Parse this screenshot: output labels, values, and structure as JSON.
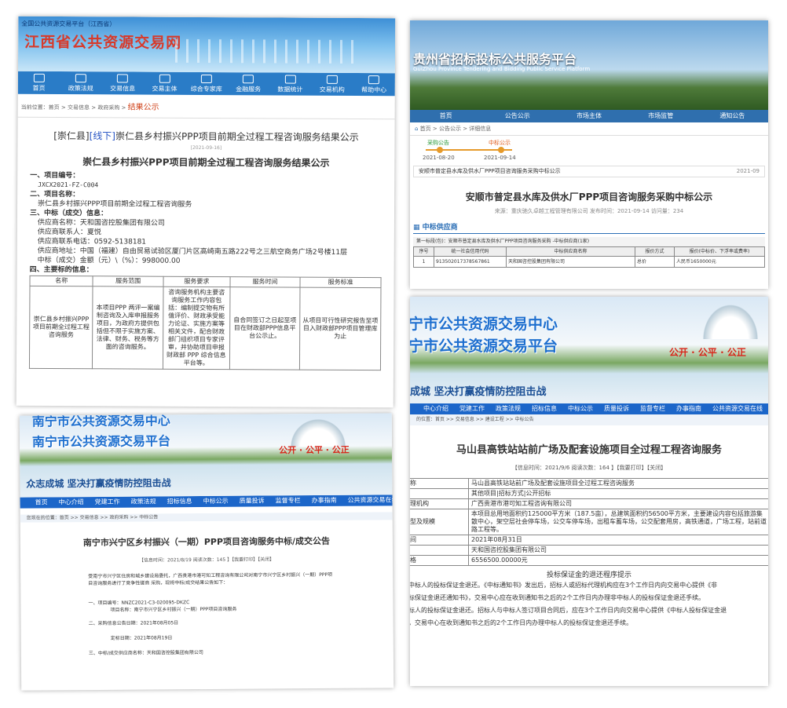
{
  "jx": {
    "platform": "全国公共资源交易平台（江西省）",
    "title": "江西省公共资源交易网",
    "nav": [
      "首页",
      "政策法规",
      "交易信息",
      "交易主体",
      "综合专家库",
      "金融服务",
      "数据统计",
      "交易机构",
      "帮助中心"
    ],
    "breadcrumb": "当前位置：首页 > 交易信息 > 政府采购 >",
    "breadcrumb_current": "结果公示",
    "heading_prefix": "[崇仁县]",
    "heading_tag": "[线下]",
    "heading_rest": "崇仁县乡村振兴PPP项目前期全过程工程咨询服务结果公示",
    "date": "[2021-09-16]",
    "doc_title": "崇仁县乡村振兴PPP项目前期全过程工程咨询服务结果公示",
    "lines": [
      "一、项目编号：",
      "JXCX2021-FZ-C004",
      "二、项目名称：",
      "崇仁县乡村振兴PPP项目前期全过程工程咨询服务",
      "三、中标（成交）信息：",
      "供应商名称：天和国咨控股集团有限公司",
      "供应商联系人：夏悦",
      "供应商联系电话：0592-5138181",
      "供应商地址：中国（福建）自由贸易试验区厦门片区高崎南五路222号之三航空商务广场2号楼11层",
      "中标（成交）金额（元）\\（%）：998000.00",
      "四、主要标的信息："
    ],
    "table_headers": [
      "名称",
      "服务范围",
      "服务要求",
      "服务时间",
      "服务标准"
    ],
    "table_row": [
      "崇仁县乡村振兴PPP项目前期全过程工程咨询服务",
      "本项目PPP 两评一案编制咨询及入库申报服务项目，为政府方提供包括但不限于实施方案、法律、财务、税务等方面的咨询服务。",
      "咨询服务机构主要咨询服务工作内容包括：编制提交物有所值评价、财政承受能力论证、实施方案等相关文件，配合财政部门组织项目专家评审，并协助项目申报财政部 PPP 综合信息平台等。",
      "自合同签订之日起至项目在财政部PPP信息平台公示止。",
      "从项目可行性研究报告至项目入财政部PPP项目管理库为止"
    ]
  },
  "gz": {
    "title": "贵州省招标投标公共服务平台",
    "subtitle": "GuiZhou Province Tendering and Bidding Public Service Platform",
    "nav": [
      "首页",
      "公告公示",
      "市场主体",
      "市场监管",
      "通知公告"
    ],
    "breadcrumb": "首页 > 公告公示 > 详细信息",
    "steps": [
      "采购公告",
      "中标公示"
    ],
    "step_dates": [
      "2021-08-20",
      "2021-09-14"
    ],
    "notice": "安顺市普定县水库及供水厂PPP项目咨询服务采购中标公示",
    "notice_date": "2021-09",
    "doc_title": "安顺市普定县水库及供水厂PPP项目咨询服务采购中标公示",
    "meta": "来源：重庆驰久卓越工程管理有限公司  发布时间：2021-09-14  访问量：234",
    "section": "中标供应商",
    "package": "第一标段(包)：安顺市普定县水库及供水厂PPP项目咨询服务采购 -中标供应商(1家)",
    "table_headers": [
      "序号",
      "统一社会信用代码",
      "中标供应商名称",
      "报价方式",
      "报价(中标价、下浮率或费率)"
    ],
    "table_row": [
      "1",
      "913502017378567861",
      "天和国咨控股集团有限公司",
      "总价",
      "人民币1650000元"
    ]
  },
  "nn1": {
    "title1": "南宁市公共资源交易中心",
    "title2": "南宁市公共资源交易平台",
    "motto": "公开 · 公平 · 公正",
    "slogan": "众志成城   坚决打赢疫情防控阻击战",
    "nav": [
      "首页",
      "中心介绍",
      "党建工作",
      "政策法规",
      "招标信息",
      "中标公示",
      "质量投诉",
      "监督专栏",
      "办事指南",
      "公共资源交易在线直播"
    ],
    "breadcrumb": "您现在的位置：首页 >> 交易信息 >> 政府采购 >> 中标公告",
    "doc_title": "南宁市兴宁区乡村振兴（一期）PPP项目咨询服务中标/成交公告",
    "meta": "【信息时间：2021/8/19  阅读次数：145 】【我要打印】【关闭】",
    "intro": "受南宁市兴宁区住房和城乡建设局委托，广西贵港市港可知工程咨询有限公司对南宁市兴宁区乡村振兴（一期）PPP项目咨询服务进行了竞争性磋商 采购，现将中标/成交结果公告如下：",
    "lines": [
      "一、项目编号：NNZC2021-C3-020095-DKZC",
      "项目名称：南宁市兴宁区乡村振兴（一期）PPP项目咨询服务",
      "二、采购信息公告日期：2021年08月05日",
      "定标日期：2021年08月19日",
      "三、中标/成交供应商名称：天和国咨控股集团有限公司"
    ]
  },
  "nn2": {
    "title1": "宁市公共资源交易中心",
    "title2": "宁市公共资源交易平台",
    "motto": "公开 · 公平 · 公正",
    "slogan": "成城   坚决打赢疫情防控阻击战",
    "nav": [
      "中心介绍",
      "党建工作",
      "政策法规",
      "招标信息",
      "中标公示",
      "质量投诉",
      "监督专栏",
      "办事指南",
      "公共资源交易在线"
    ],
    "breadcrumb": "的位置：首页 >> 交易信息 >> 建设工程 >> 中标公告",
    "doc_title": "马山县高铁站站前广场及配套设施项目全过程工程咨询服务",
    "meta": "【信息时间：2021/9/6  阅读次数：164 】【我要打印】【关闭】",
    "rows": [
      [
        "称",
        "马山县高铁站站前广场及配套设施项目全过程工程咨询服务"
      ],
      [
        "",
        "其他项目|招标方式|公开招标"
      ],
      [
        "理机构",
        "广西贵港市港可知工程咨询有限公司"
      ],
      [
        "型及规模",
        "本项目总用地面积约125000平方米（187.5亩），总建筑面积约56500平方米，主要建设内容包括旅游集散中心，架空层社会停车场，公交车停车场，出租车蓄车场，公交配套用房，高铁通道，广场工程，站前道路工程等。"
      ],
      [
        "间",
        "2021年08月31日"
      ],
      [
        "",
        "天和国咨控股集团有限公司"
      ],
      [
        "格",
        "6556500.00000元"
      ]
    ],
    "section": "投标保证金的退还程序提示",
    "paras": [
      "中标人的投标保证金退还。《中标通知书》发出后，招标人或招标代理机构应在3个工作日内向交易中心提供《非",
      "标保证金退还通知书》，交易中心应在收到通知书之后的2个工作日内办理非中标人的投标保证金退还手续。",
      "标人的投标保证金退还。招标人与中标人签订项目合同后，应在3个工作日内向交易中心提供《中标人投标保证金退",
      "，交易中心在收到通知书之后的2个工作日内办理中标人的投标保证金退还手续。"
    ]
  }
}
